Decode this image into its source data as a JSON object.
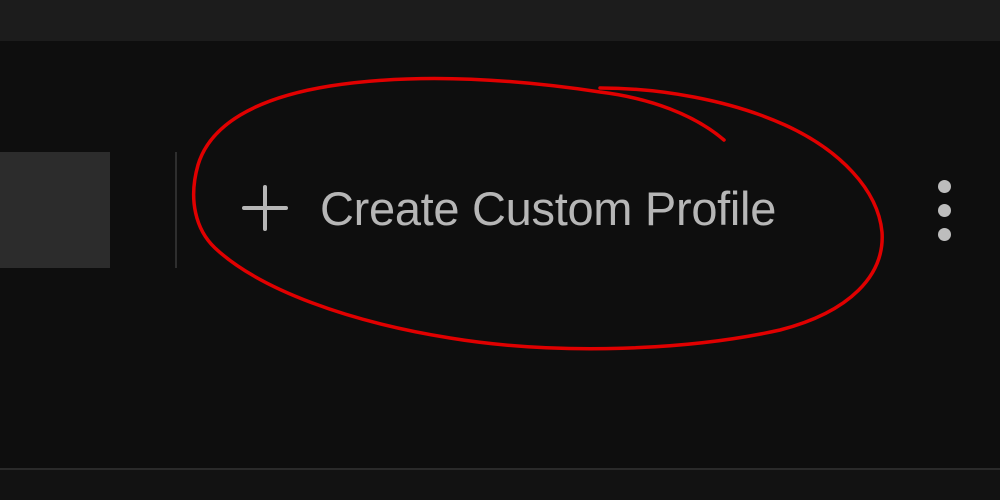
{
  "toolbar": {
    "create_profile_label": "Create Custom Profile",
    "create_profile_icon": "plus-icon",
    "more_options_icon": "kebab-menu-icon"
  },
  "colors": {
    "background": "#0e0e0e",
    "top_bar": "#1c1c1c",
    "text": "#b6b6b6",
    "annotation": "#e00000"
  }
}
